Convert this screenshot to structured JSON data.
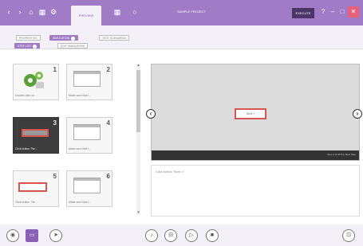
{
  "titlebar": {
    "tab_label": "PREVIEW",
    "project_title": "SAMPLE PROJECT",
    "dark_button_label": "EXECUTE",
    "icons": [
      "back-icon",
      "forward-icon",
      "home-icon",
      "grid-icon",
      "settings-icon",
      "help-icon"
    ]
  },
  "subbar": {
    "row1": [
      "PROPERTIES",
      "SIMULATION",
      "TEST SCENARIOS"
    ],
    "row2": [
      "STEP LIST",
      "EDIT SIMULATION"
    ]
  },
  "slides": [
    {
      "num": "1",
      "caption": "Double-click on ..."
    },
    {
      "num": "2",
      "caption": "Make sure that t..."
    },
    {
      "num": "3",
      "caption": "Click button \"Ne..."
    },
    {
      "num": "4",
      "caption": "Make sure that t..."
    },
    {
      "num": "5",
      "caption": "Click button \"Ne..."
    },
    {
      "num": "6",
      "caption": "Make sure that t..."
    }
  ],
  "preview": {
    "button_label": "Next >",
    "status": "Step 3 of 24   Pro Next Step",
    "prev_icon": "chevron-left-icon",
    "next_icon": "chevron-right-icon"
  },
  "notes": {
    "text": "Click button \"Next >\""
  },
  "bottombar": {
    "left_buttons": [
      "record-icon",
      "slides-icon",
      "pointer-icon"
    ],
    "center_buttons": [
      "audio-icon",
      "record-step-icon",
      "play-icon",
      "stop-icon"
    ],
    "right_button": "fullscreen-icon"
  },
  "colors": {
    "accent": "#a07cc6",
    "highlight": "#d9534f"
  }
}
